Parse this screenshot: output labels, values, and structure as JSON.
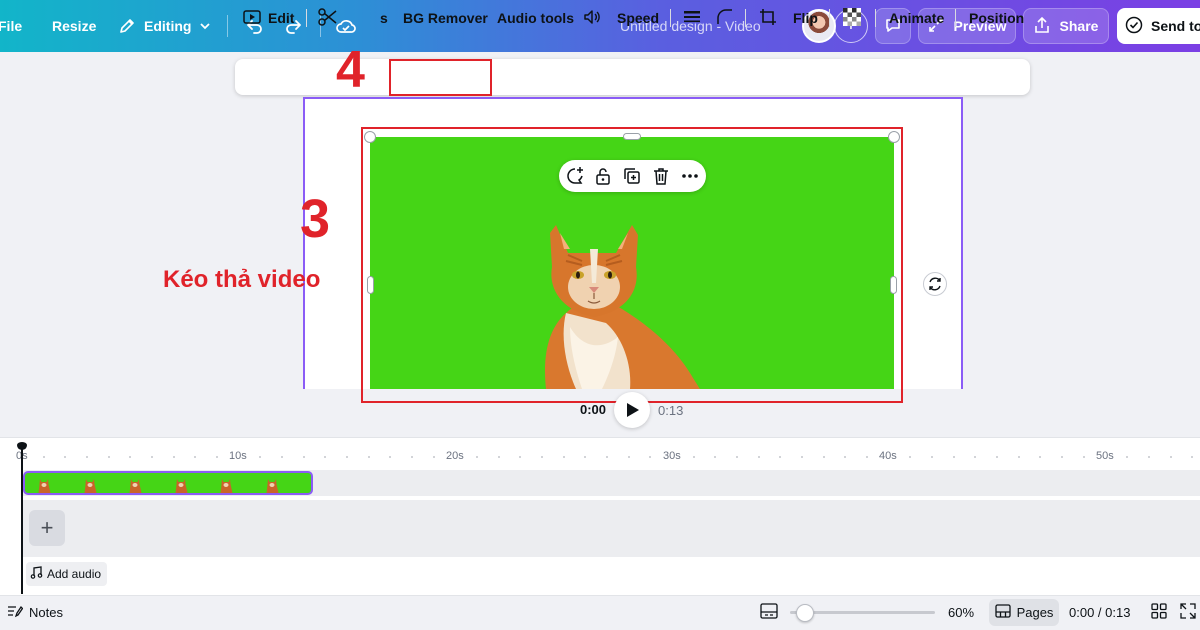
{
  "topbar": {
    "file": "File",
    "resize": "Resize",
    "mode": "Editing",
    "doc_title": "Untitled design - Video",
    "preview": "Preview",
    "share": "Share",
    "send": "Send to",
    "gradient_colors": [
      "#12b5c9",
      "#5a5fe0",
      "#7b3fe4"
    ]
  },
  "context_toolbar": {
    "edit": "Edit",
    "trim_fragment": "s",
    "bg_remover": "BG Remover",
    "audio_tools": "Audio tools",
    "speed": "Speed",
    "flip": "Flip",
    "animate": "Animate",
    "position": "Position"
  },
  "annotations": {
    "step4": "4",
    "step3": "3",
    "drag_text": "Kéo thả video",
    "color": "#e0232a"
  },
  "player": {
    "current": "0:00",
    "total": "0:13"
  },
  "timeline": {
    "ticks": [
      "0s",
      "10s",
      "20s",
      "30s",
      "40s",
      "50s"
    ],
    "add_audio": "Add audio",
    "clip_color": "#45d516",
    "selection_color": "#8b5cf6"
  },
  "bottombar": {
    "notes": "Notes",
    "zoom": "60%",
    "pages": "Pages",
    "time": "0:00 / 0:13",
    "zoom_fraction": 0.1
  }
}
